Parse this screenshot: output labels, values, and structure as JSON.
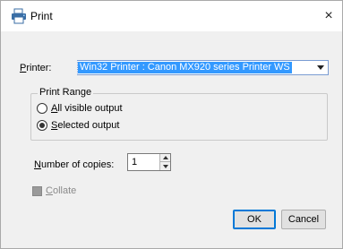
{
  "window": {
    "title": "Print",
    "close_glyph": "×"
  },
  "printer": {
    "label_underlined": "P",
    "label_rest": "rinter:",
    "selected_value": "Win32 Printer : Canon MX920 series Printer WS"
  },
  "print_range": {
    "legend": "Print Range",
    "options": [
      {
        "underlined": "A",
        "rest": "ll visible output",
        "checked": false
      },
      {
        "underlined": "S",
        "rest": "elected output",
        "checked": true
      }
    ]
  },
  "copies": {
    "label_underlined": "N",
    "label_rest": "umber of copies:",
    "value": "1"
  },
  "collate": {
    "label_underlined": "C",
    "label_rest": "ollate",
    "enabled": false
  },
  "buttons": {
    "ok": "OK",
    "cancel": "Cancel"
  },
  "colors": {
    "selection": "#3399ff",
    "default_button_border": "#0078d7",
    "dialog_bg": "#f0f0f0"
  }
}
